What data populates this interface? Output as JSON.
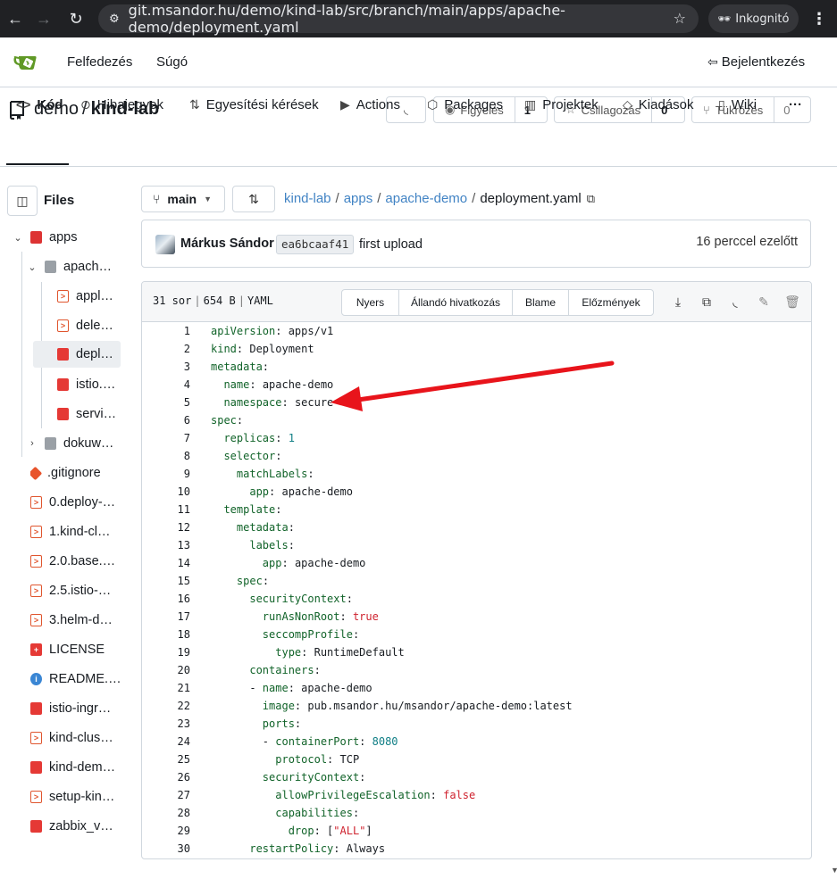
{
  "browser": {
    "url": "git.msandor.hu/demo/kind-lab/src/branch/main/apps/apache-demo/deployment.yaml",
    "incognito_label": "Inkognitó"
  },
  "topnav": {
    "explore": "Felfedezés",
    "help": "Súgó",
    "login": "Bejelentkezés"
  },
  "repo": {
    "owner": "demo",
    "separator": "/",
    "name": "kind-lab",
    "watch_label": "Figyelés",
    "watch_count": "1",
    "star_label": "Csillagozás",
    "star_count": "0",
    "fork_label": "Tükrözés",
    "fork_count": "0"
  },
  "tabs": [
    {
      "label": "Kód",
      "icon": "code-icon"
    },
    {
      "label": "Hibajegyek",
      "icon": "issue-icon"
    },
    {
      "label": "Egyesítési kérések",
      "icon": "pull-request-icon"
    },
    {
      "label": "Actions",
      "icon": "actions-icon"
    },
    {
      "label": "Packages",
      "icon": "package-icon"
    },
    {
      "label": "Projektek",
      "icon": "project-icon"
    },
    {
      "label": "Kiadások",
      "icon": "tag-icon"
    },
    {
      "label": "Wiki",
      "icon": "book-icon"
    }
  ],
  "sidebar": {
    "title": "Files",
    "items": [
      {
        "label": "apps",
        "type": "folder-open"
      },
      {
        "label": "apach…",
        "type": "folder-open"
      },
      {
        "label": "appl…",
        "type": "shell"
      },
      {
        "label": "dele…",
        "type": "shell"
      },
      {
        "label": "depl…",
        "type": "file"
      },
      {
        "label": "istio.…",
        "type": "file"
      },
      {
        "label": "servi…",
        "type": "file"
      },
      {
        "label": "dokuw…",
        "type": "folder"
      },
      {
        "label": ".gitignore",
        "type": "git"
      },
      {
        "label": "0.deploy-…",
        "type": "shell"
      },
      {
        "label": "1.kind-cl…",
        "type": "shell"
      },
      {
        "label": "2.0.base.…",
        "type": "shell"
      },
      {
        "label": "2.5.istio-…",
        "type": "shell"
      },
      {
        "label": "3.helm-d…",
        "type": "shell"
      },
      {
        "label": "LICENSE",
        "type": "license"
      },
      {
        "label": "README.…",
        "type": "info"
      },
      {
        "label": "istio-ingr…",
        "type": "file"
      },
      {
        "label": "kind-clus…",
        "type": "shell"
      },
      {
        "label": "kind-dem…",
        "type": "file"
      },
      {
        "label": "setup-kin…",
        "type": "shell"
      },
      {
        "label": "zabbix_v…",
        "type": "file"
      }
    ]
  },
  "branch": {
    "name": "main"
  },
  "breadcrumb": {
    "repo": "kind-lab",
    "dir1": "apps",
    "dir2": "apache-demo",
    "file": "deployment.yaml"
  },
  "commit": {
    "author": "Márkus Sándor",
    "sha": "ea6bcaaf41",
    "message": "first upload",
    "time": "16 perccel ezelőtt"
  },
  "file": {
    "lines_info": "31 sor",
    "size": "654 B",
    "lang": "YAML",
    "buttons": [
      "Nyers",
      "Állandó hivatkozás",
      "Blame",
      "Előzmények"
    ]
  },
  "code_lines": [
    "1",
    "2",
    "3",
    "4",
    "5",
    "6",
    "7",
    "8",
    "9",
    "10",
    "11",
    "12",
    "13",
    "14",
    "15",
    "16",
    "17",
    "18",
    "19",
    "20",
    "21",
    "22",
    "23",
    "24",
    "25",
    "26",
    "27",
    "28",
    "29",
    "30"
  ],
  "code": {
    "l1k": "apiVersion",
    "l1v": "apps/v1",
    "l2k": "kind",
    "l2v": "Deployment",
    "l3k": "metadata",
    "l4k": "name",
    "l4v": "apache-demo",
    "l5k": "namespace",
    "l5v": "secure",
    "l6k": "spec",
    "l7k": "replicas",
    "l7v": "1",
    "l8k": "selector",
    "l9k": "matchLabels",
    "l10k": "app",
    "l10v": "apache-demo",
    "l11k": "template",
    "l12k": "metadata",
    "l13k": "labels",
    "l14k": "app",
    "l14v": "apache-demo",
    "l15k": "spec",
    "l16k": "securityContext",
    "l17k": "runAsNonRoot",
    "l17v": "true",
    "l18k": "seccompProfile",
    "l19k": "type",
    "l19v": "RuntimeDefault",
    "l20k": "containers",
    "l21k": "name",
    "l21v": "apache-demo",
    "l22k": "image",
    "l22v": "pub.msandor.hu/msandor/apache-demo:latest",
    "l23k": "ports",
    "l24k": "containerPort",
    "l24v": "8080",
    "l25k": "protocol",
    "l25v": "TCP",
    "l26k": "securityContext",
    "l27k": "allowPrivilegeEscalation",
    "l27v": "false",
    "l28k": "capabilities",
    "l29k": "drop",
    "l29v": "\"ALL\"",
    "l30k": "restartPolicy",
    "l30v": "Always"
  },
  "colors": {
    "accent_link": "#4183c4",
    "yaml_key": "#116329",
    "yaml_number": "#0f7e85",
    "yaml_bool": "#cf222e",
    "annotation_arrow": "#e8141b"
  }
}
